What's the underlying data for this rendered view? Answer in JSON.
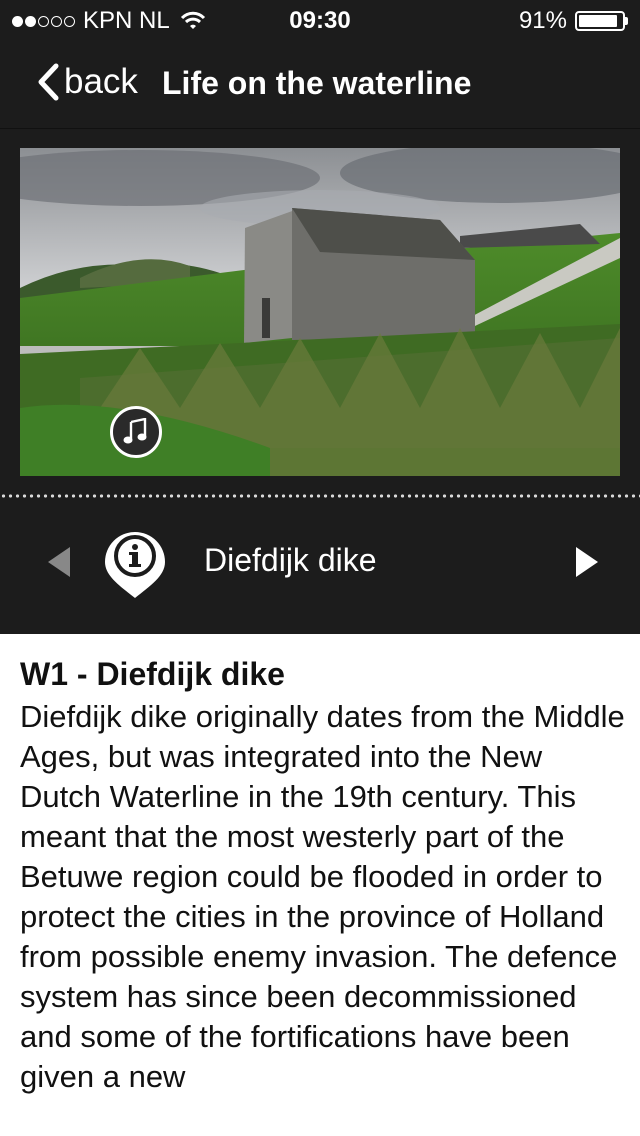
{
  "status_bar": {
    "carrier": "KPN NL",
    "time": "09:30",
    "battery": "91%",
    "battery_level": 0.91,
    "signal_bars": 2,
    "icons": [
      "signal-icon",
      "wifi-icon",
      "battery-icon"
    ]
  },
  "nav": {
    "back_label": "back",
    "title": "Life on the waterline",
    "icons": [
      "chevron-left-icon"
    ]
  },
  "media": {
    "audio_icon": "music-note-icon"
  },
  "poi": {
    "name": "Diefdijk dike",
    "icons": [
      "prev-arrow-icon",
      "info-pin-icon",
      "next-arrow-icon"
    ]
  },
  "article": {
    "title": "W1 - Diefdijk dike",
    "body": "Diefdijk dike originally dates from the Middle Ages, but was integrated into the New Dutch Waterline in the 19th century. This meant that the most westerly part of the Betuwe region could be flooded in order to protect the cities in the province of Holland from possible enemy invasion. The defence system has since been decommissioned and some of the fortifications have been given a new"
  },
  "colors": {
    "header_bg": "#1c1c1c",
    "text_light": "#ffffff",
    "content_bg": "#ffffff",
    "text_dark": "#111111",
    "disabled_arrow": "#888888"
  }
}
